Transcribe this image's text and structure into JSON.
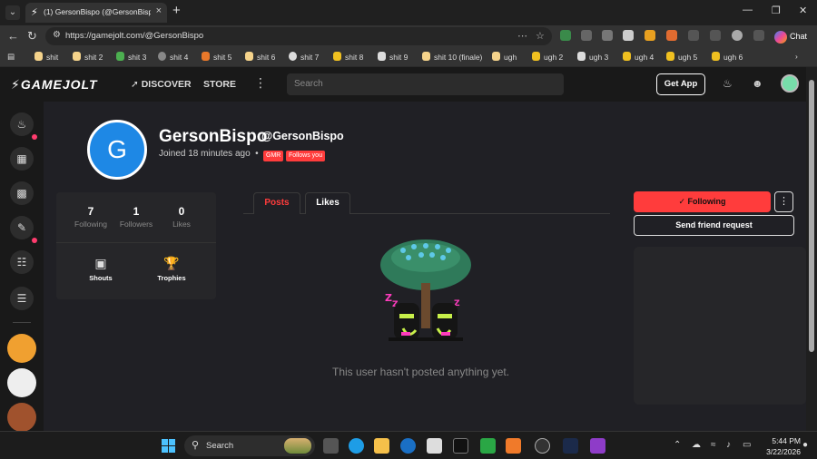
{
  "browser": {
    "tab_title": "(1) GersonBispo (@GersonBispo) ·",
    "url": "https://gamejolt.com/@GersonBispo",
    "chat_label": "Chat",
    "bookmarks": [
      "shit",
      "shit 2",
      "shit 3",
      "shit 4",
      "shit 5",
      "shit 6",
      "shit 7",
      "shit 8",
      "shit 9",
      "shit 10 (finale)",
      "ugh",
      "ugh 2",
      "ugh 3",
      "ugh 4",
      "ugh 5",
      "ugh 6"
    ]
  },
  "site": {
    "logo": "GAMEJOLT",
    "nav_discover": "DISCOVER",
    "nav_store": "STORE",
    "search_placeholder": "Search",
    "get_app": "Get App"
  },
  "profile": {
    "avatar_letter": "G",
    "display_name": "GersonBispo",
    "username": "@GersonBispo",
    "joined": "Joined 18 minutes ago",
    "badges": [
      "GMR",
      "Follows you"
    ],
    "stats": [
      {
        "value": "7",
        "label": "Following"
      },
      {
        "value": "1",
        "label": "Followers"
      },
      {
        "value": "0",
        "label": "Likes"
      }
    ],
    "shortcuts": [
      {
        "label": "Shouts",
        "icon": "chat-bubble-icon"
      },
      {
        "label": "Trophies",
        "icon": "trophy-icon"
      }
    ],
    "tabs": [
      "Posts",
      "Likes"
    ],
    "empty_message": "This user hasn't posted anything yet.",
    "following_label": "Following",
    "friend_request_label": "Send friend request"
  },
  "taskbar": {
    "search_label": "Search",
    "time": "5:44 PM",
    "date": "3/22/2026"
  },
  "colors": {
    "accent": "#ff3c3c",
    "avatar_bg": "#1e88e5",
    "page_bg": "#202025"
  }
}
